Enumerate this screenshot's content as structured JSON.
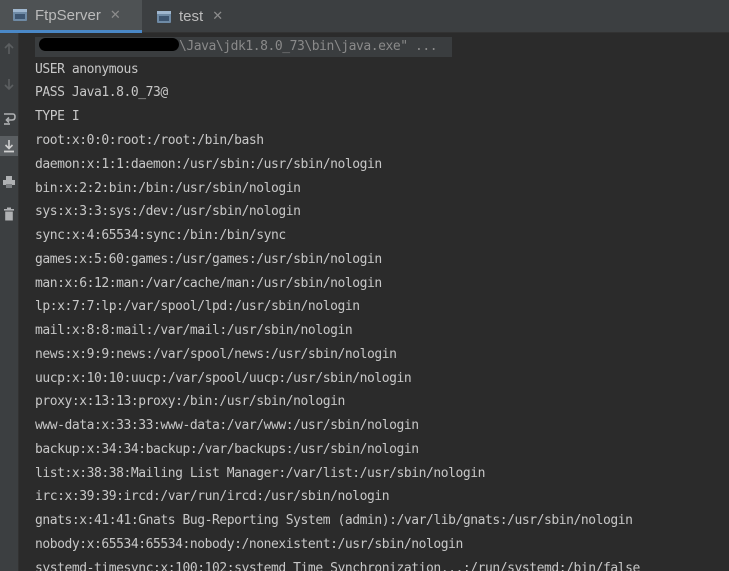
{
  "tabs": [
    {
      "label": "FtpServer",
      "active": true
    },
    {
      "label": "test",
      "active": false
    }
  ],
  "tab_close_glyph": "✕",
  "icons": {
    "tab": "class-file-icon",
    "toolbar": [
      "arrow-up-icon",
      "arrow-down-icon",
      "soft-wrap-icon",
      "scroll-to-end-icon",
      "print-icon",
      "trash-icon"
    ]
  },
  "colors": {
    "background": "#2b2b2b",
    "panel": "#3c3f41",
    "accent": "#4a88c7",
    "text": "#c7c7c7"
  },
  "console": {
    "command": "\\Java\\jdk1.8.0_73\\bin\\java.exe\" ...",
    "lines": [
      "USER anonymous",
      "PASS Java1.8.0_73@",
      "TYPE I",
      "root:x:0:0:root:/root:/bin/bash",
      "daemon:x:1:1:daemon:/usr/sbin:/usr/sbin/nologin",
      "bin:x:2:2:bin:/bin:/usr/sbin/nologin",
      "sys:x:3:3:sys:/dev:/usr/sbin/nologin",
      "sync:x:4:65534:sync:/bin:/bin/sync",
      "games:x:5:60:games:/usr/games:/usr/sbin/nologin",
      "man:x:6:12:man:/var/cache/man:/usr/sbin/nologin",
      "lp:x:7:7:lp:/var/spool/lpd:/usr/sbin/nologin",
      "mail:x:8:8:mail:/var/mail:/usr/sbin/nologin",
      "news:x:9:9:news:/var/spool/news:/usr/sbin/nologin",
      "uucp:x:10:10:uucp:/var/spool/uucp:/usr/sbin/nologin",
      "proxy:x:13:13:proxy:/bin:/usr/sbin/nologin",
      "www-data:x:33:33:www-data:/var/www:/usr/sbin/nologin",
      "backup:x:34:34:backup:/var/backups:/usr/sbin/nologin",
      "list:x:38:38:Mailing List Manager:/var/list:/usr/sbin/nologin",
      "irc:x:39:39:ircd:/var/run/ircd:/usr/sbin/nologin",
      "gnats:x:41:41:Gnats Bug-Reporting System (admin):/var/lib/gnats:/usr/sbin/nologin",
      "nobody:x:65534:65534:nobody:/nonexistent:/usr/sbin/nologin",
      "systemd-timesync:x:100:102:systemd Time Synchronization,,,:/run/systemd:/bin/false"
    ]
  }
}
